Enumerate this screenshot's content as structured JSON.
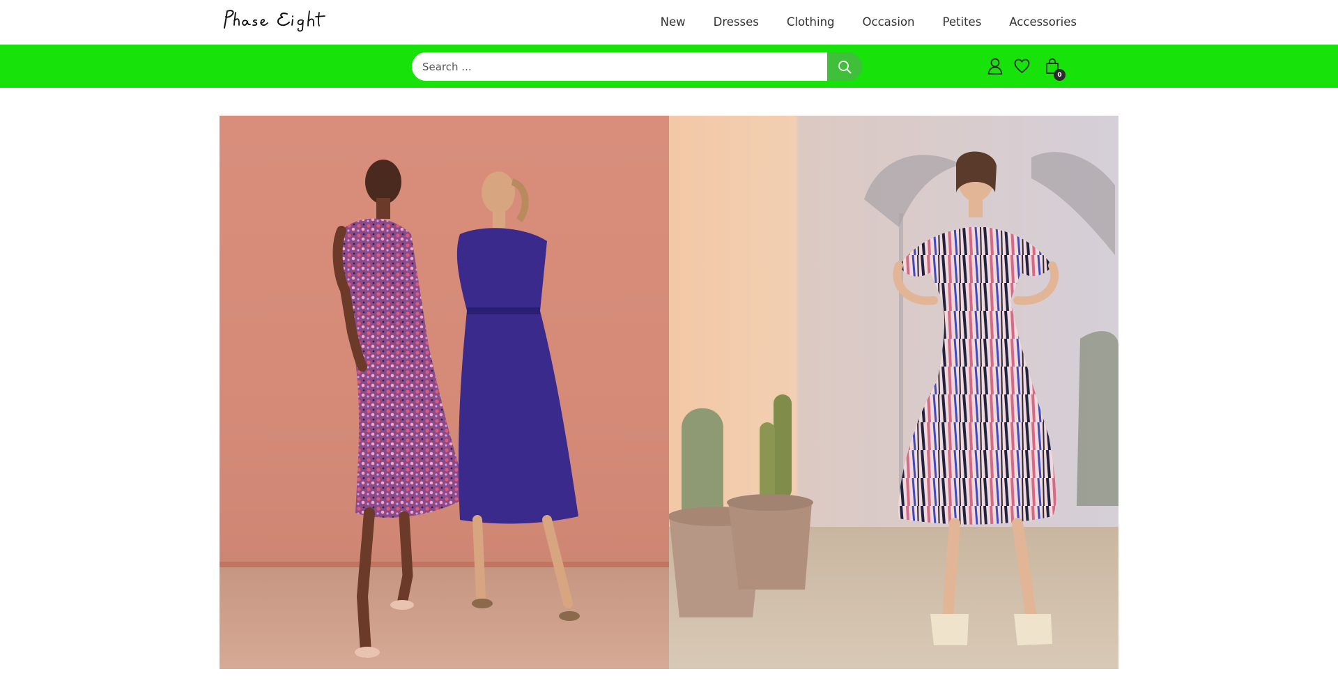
{
  "brand": {
    "logo_text": "Phase Eight"
  },
  "nav": {
    "items": [
      {
        "label": "New"
      },
      {
        "label": "Dresses"
      },
      {
        "label": "Clothing"
      },
      {
        "label": "Occasion"
      },
      {
        "label": "Petites"
      },
      {
        "label": "Accessories"
      }
    ]
  },
  "search": {
    "placeholder": "Search ...",
    "value": "",
    "button_icon": "search-icon"
  },
  "header_icons": {
    "account_icon": "user-icon",
    "wishlist_icon": "heart-icon",
    "cart_icon": "shopping-bag-icon",
    "cart_count": "0"
  },
  "colors": {
    "bar_background": "#17e30a",
    "search_button": "#3fbf3a",
    "cart_badge": "#2b2b2b"
  },
  "hero": {
    "images": [
      {
        "name": "two-women-in-dresses-photo"
      },
      {
        "name": "woman-in-printed-dress-with-cacti-photo"
      }
    ]
  }
}
